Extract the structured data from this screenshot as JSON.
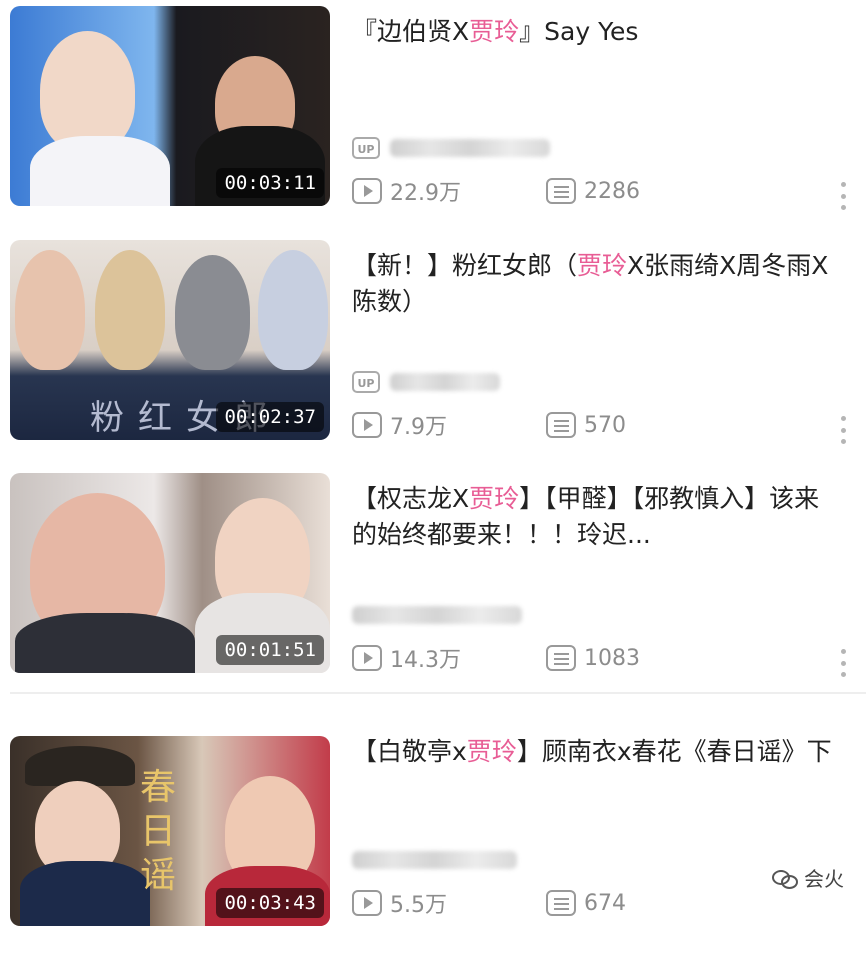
{
  "videos": [
    {
      "title_parts": [
        "『边伯贤X",
        "贾玲",
        "』Say Yes"
      ],
      "duration": "00:03:11",
      "plays": "22.9万",
      "danmaku": "2286"
    },
    {
      "title_parts": [
        "【新！】粉红女郎（",
        "贾玲",
        "X张雨绮X周冬雨X陈数）"
      ],
      "duration": "00:02:37",
      "plays": "7.9万",
      "danmaku": "570",
      "thumb_overlay": "粉红女郎"
    },
    {
      "title_parts": [
        "【权志龙X",
        "贾玲",
        "】【甲醛】【邪教慎入】该来的始终都要来！！！玲迟..."
      ],
      "duration": "00:01:51",
      "plays": "14.3万",
      "danmaku": "1083"
    },
    {
      "title_parts": [
        "【白敬亭x",
        "贾玲",
        "】顾南衣x春花《春日谣》下"
      ],
      "duration": "00:03:43",
      "plays": "5.5万",
      "danmaku": "674",
      "thumb_overlay": "春日谣"
    }
  ],
  "uploader_badge": "UP",
  "watermark": "会火",
  "icons": {
    "plays": "play-count-icon",
    "danmaku": "danmaku-icon",
    "more": "more-vertical-icon",
    "uploader": "up-badge-icon",
    "watermark": "wechat-icon"
  },
  "colors": {
    "highlight": "#e85d95",
    "meta": "#8c8c8c",
    "duration_bg": "rgba(0,0,0,0.55)"
  }
}
